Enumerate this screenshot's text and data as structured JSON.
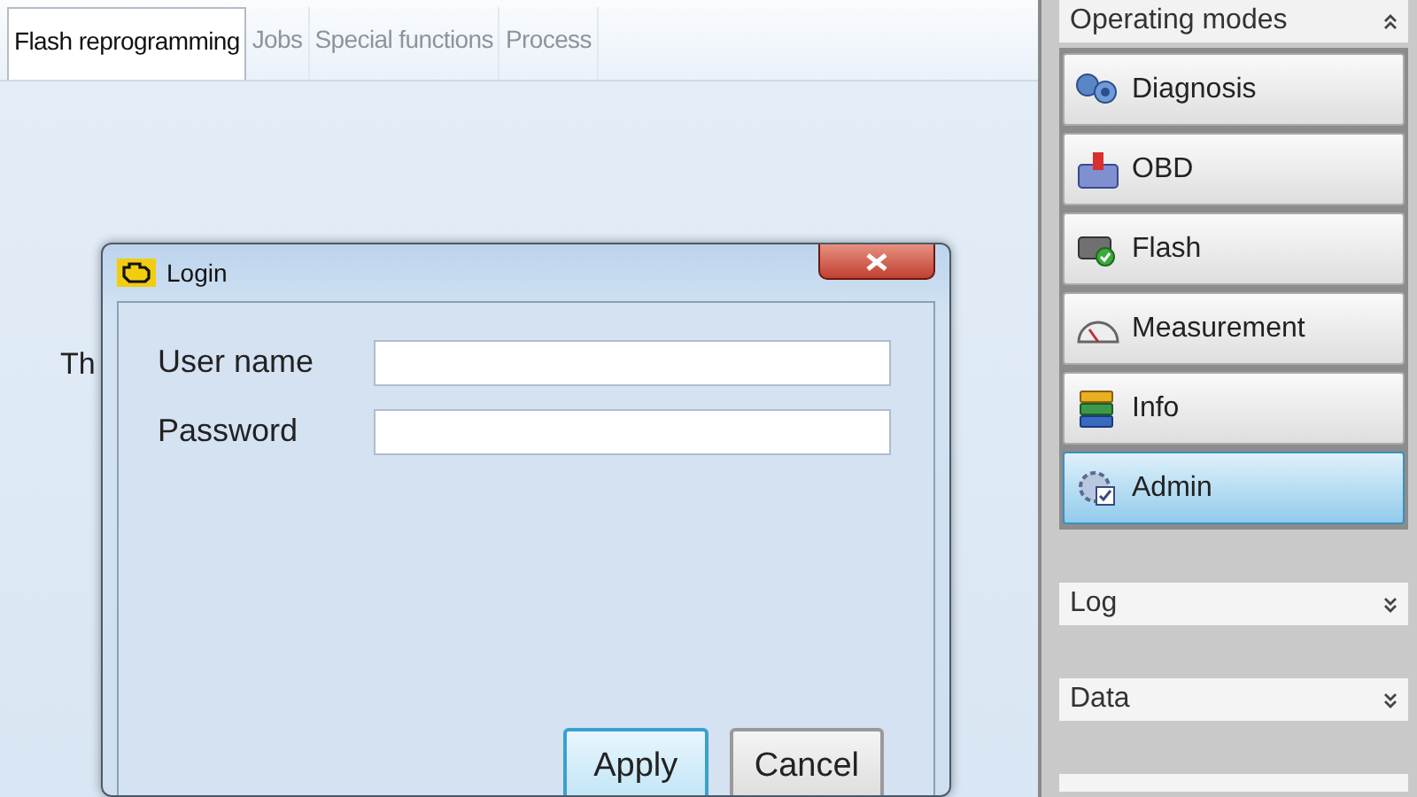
{
  "tabs": [
    {
      "label": "Flash reprogramming",
      "selected": true
    },
    {
      "label": "Jobs",
      "selected": false
    },
    {
      "label": "Special functions",
      "selected": false
    },
    {
      "label": "Process",
      "selected": false
    }
  ],
  "content": {
    "text": "Th"
  },
  "dialog": {
    "title": "Login",
    "fields": [
      {
        "label": "User name"
      },
      {
        "label": "Password"
      }
    ],
    "buttons": [
      {
        "label": "Apply",
        "default": true
      },
      {
        "label": "Cancel",
        "default": false
      }
    ]
  },
  "sidebar": {
    "header": "Operating modes",
    "modes": [
      {
        "label": "Diagnosis",
        "kind": "diagnosis",
        "selected": false
      },
      {
        "label": "OBD",
        "kind": "obd",
        "selected": false
      },
      {
        "label": "Flash",
        "kind": "flash",
        "selected": false
      },
      {
        "label": "Measurement",
        "kind": "measurement",
        "selected": false
      },
      {
        "label": "Info",
        "kind": "info",
        "selected": false
      },
      {
        "label": "Admin",
        "kind": "admin",
        "selected": true
      }
    ],
    "panels": [
      {
        "label": "Log"
      },
      {
        "label": "Data"
      }
    ]
  }
}
